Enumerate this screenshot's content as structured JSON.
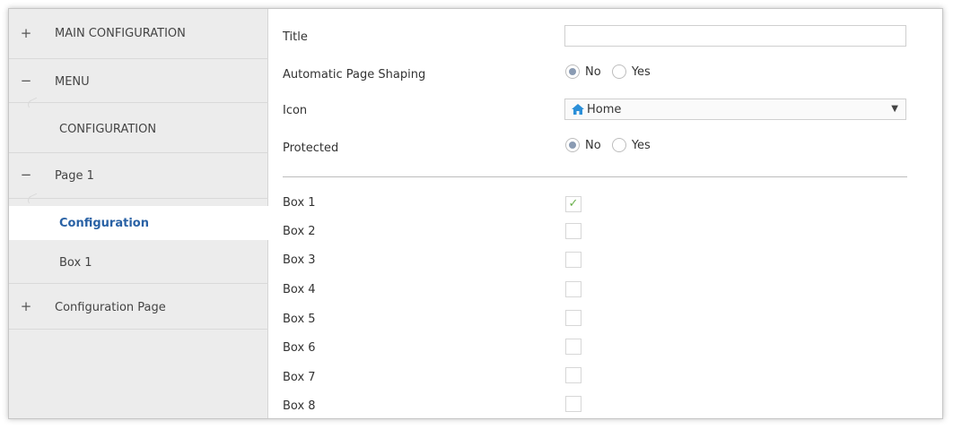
{
  "sidebar": {
    "items": [
      {
        "toggle": "+",
        "label": "MAIN CONFIGURATION"
      },
      {
        "toggle": "−",
        "label": "MENU"
      },
      {
        "toggle": "",
        "label": "CONFIGURATION"
      },
      {
        "toggle": "−",
        "label": "Page 1"
      },
      {
        "toggle": "",
        "label": "Configuration"
      },
      {
        "toggle": "",
        "label": "Box 1"
      },
      {
        "toggle": "+",
        "label": "Configuration Page"
      }
    ]
  },
  "form": {
    "title": {
      "label": "Title",
      "value": ""
    },
    "auto_page_shaping": {
      "label": "Automatic Page Shaping",
      "selected": "No",
      "options": [
        "No",
        "Yes"
      ]
    },
    "icon": {
      "label": "Icon",
      "value": "Home",
      "icon": "house-icon"
    },
    "protected": {
      "label": "Protected",
      "selected": "No",
      "options": [
        "No",
        "Yes"
      ]
    }
  },
  "boxes": [
    {
      "label": "Box 1",
      "checked": true
    },
    {
      "label": "Box 2",
      "checked": false
    },
    {
      "label": "Box 3",
      "checked": false
    },
    {
      "label": "Box 4",
      "checked": false
    },
    {
      "label": "Box 5",
      "checked": false
    },
    {
      "label": "Box 6",
      "checked": false
    },
    {
      "label": "Box 7",
      "checked": false
    },
    {
      "label": "Box 8",
      "checked": false
    }
  ],
  "colors": {
    "accent": "#2a62a5",
    "check": "#6ab04c",
    "sidebar_bg": "#ececec",
    "house_icon": "#2b8fd8"
  }
}
